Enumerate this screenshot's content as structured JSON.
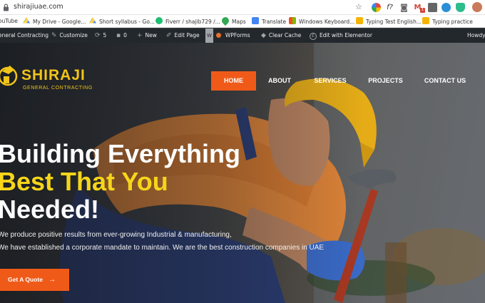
{
  "browser": {
    "url": "shirajiuae.com",
    "bookmarks": [
      {
        "label": "ouTube",
        "icon": "youtube-icon"
      },
      {
        "label": "My Drive - Google...",
        "icon": "drive-icon"
      },
      {
        "label": "Short syllabus - Go...",
        "icon": "drive-icon"
      },
      {
        "label": "Fiverr / shajib729 /...",
        "icon": "fiverr-icon"
      },
      {
        "label": "Maps",
        "icon": "maps-icon"
      },
      {
        "label": "Translate",
        "icon": "translate-icon"
      },
      {
        "label": "Windows Keyboard...",
        "icon": "windows-icon"
      },
      {
        "label": "Typing Test English...",
        "icon": "bookmark-icon"
      },
      {
        "label": "Typing practice",
        "icon": "bookmark-icon"
      }
    ],
    "extensions": {
      "fx_label": "f?",
      "mail_label": "M",
      "mail_badge": "1"
    }
  },
  "wp_admin": {
    "site": "eneral Contracting",
    "customize": "Customize",
    "updates_count": "5",
    "comments_count": "0",
    "new": "New",
    "edit_page": "Edit Page",
    "wpforms": "WPForms",
    "clear_cache": "Clear Cache",
    "elementor": "Edit with Elementor",
    "howdy": "Howdy"
  },
  "site": {
    "logo_name": "SHIRAJI",
    "logo_sub": "GENERAL CONTRACTING",
    "nav": [
      {
        "label": "HOME",
        "active": true
      },
      {
        "label": "ABOUT",
        "active": false
      },
      {
        "label": "SERVICES",
        "active": false
      },
      {
        "label": "PROJECTS",
        "active": false
      },
      {
        "label": "CONTACT US",
        "active": false
      }
    ],
    "headline": [
      "Building Everything",
      "Best That You",
      "Needed!"
    ],
    "paragraph": [
      "We produce positive results from ever-growing Industrial & manufacturing,",
      "We have established a corporate mandate to maintain. We are the best construction companies in UAE"
    ],
    "cta_label": "Get A Quote",
    "colors": {
      "accent_orange": "#f05a19",
      "headline_yellow": "#f6d51a",
      "logo_yellow": "#f2c419",
      "admin_bar": "#23282d"
    }
  }
}
